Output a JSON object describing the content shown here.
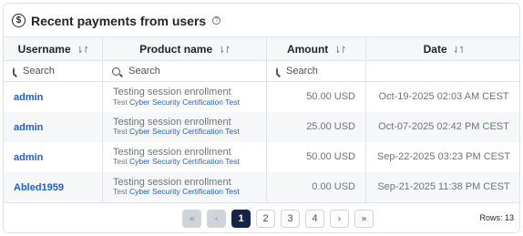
{
  "header": {
    "title": "Recent payments from users",
    "dollar_glyph": "$",
    "help_glyph": "?"
  },
  "columns": [
    {
      "label": "Username",
      "sort": "⇂↾"
    },
    {
      "label": "Product name",
      "sort": "⇂↾"
    },
    {
      "label": "Amount",
      "sort": "⇂↾"
    },
    {
      "label": "Date",
      "sort": "⇃↿"
    }
  ],
  "filters": {
    "placeholder": "Search"
  },
  "rows": [
    {
      "username": "admin",
      "product": "Testing session enrollment",
      "sub_prefix": "Test",
      "sub_link": "Cyber Security Certification Test",
      "amount": "50.00 USD",
      "date": "Oct-19-2025 02:03 AM CEST"
    },
    {
      "username": "admin",
      "product": "Testing session enrollment",
      "sub_prefix": "Test",
      "sub_link": "Cyber Security Certification Test",
      "amount": "25.00 USD",
      "date": "Oct-07-2025 02:42 PM CEST"
    },
    {
      "username": "admin",
      "product": "Testing session enrollment",
      "sub_prefix": "Test",
      "sub_link": "Cyber Security Certification Test",
      "amount": "50.00 USD",
      "date": "Sep-22-2025 03:23 PM CEST"
    },
    {
      "username": "Abled1959",
      "product": "Testing session enrollment",
      "sub_prefix": "Test",
      "sub_link": "Cyber Security Certification Test",
      "amount": "0.00 USD",
      "date": "Sep-21-2025 11:38 PM CEST"
    }
  ],
  "pagination": {
    "first": "«",
    "prev": "‹",
    "next": "›",
    "last": "»",
    "pages": [
      "1",
      "2",
      "3",
      "4"
    ],
    "current": "1"
  },
  "footer": {
    "rows_label": "Rows: 13"
  },
  "colors": {
    "link": "#1f5fc4",
    "active_page": "#17244a",
    "header_bg": "#f6f7f9"
  }
}
